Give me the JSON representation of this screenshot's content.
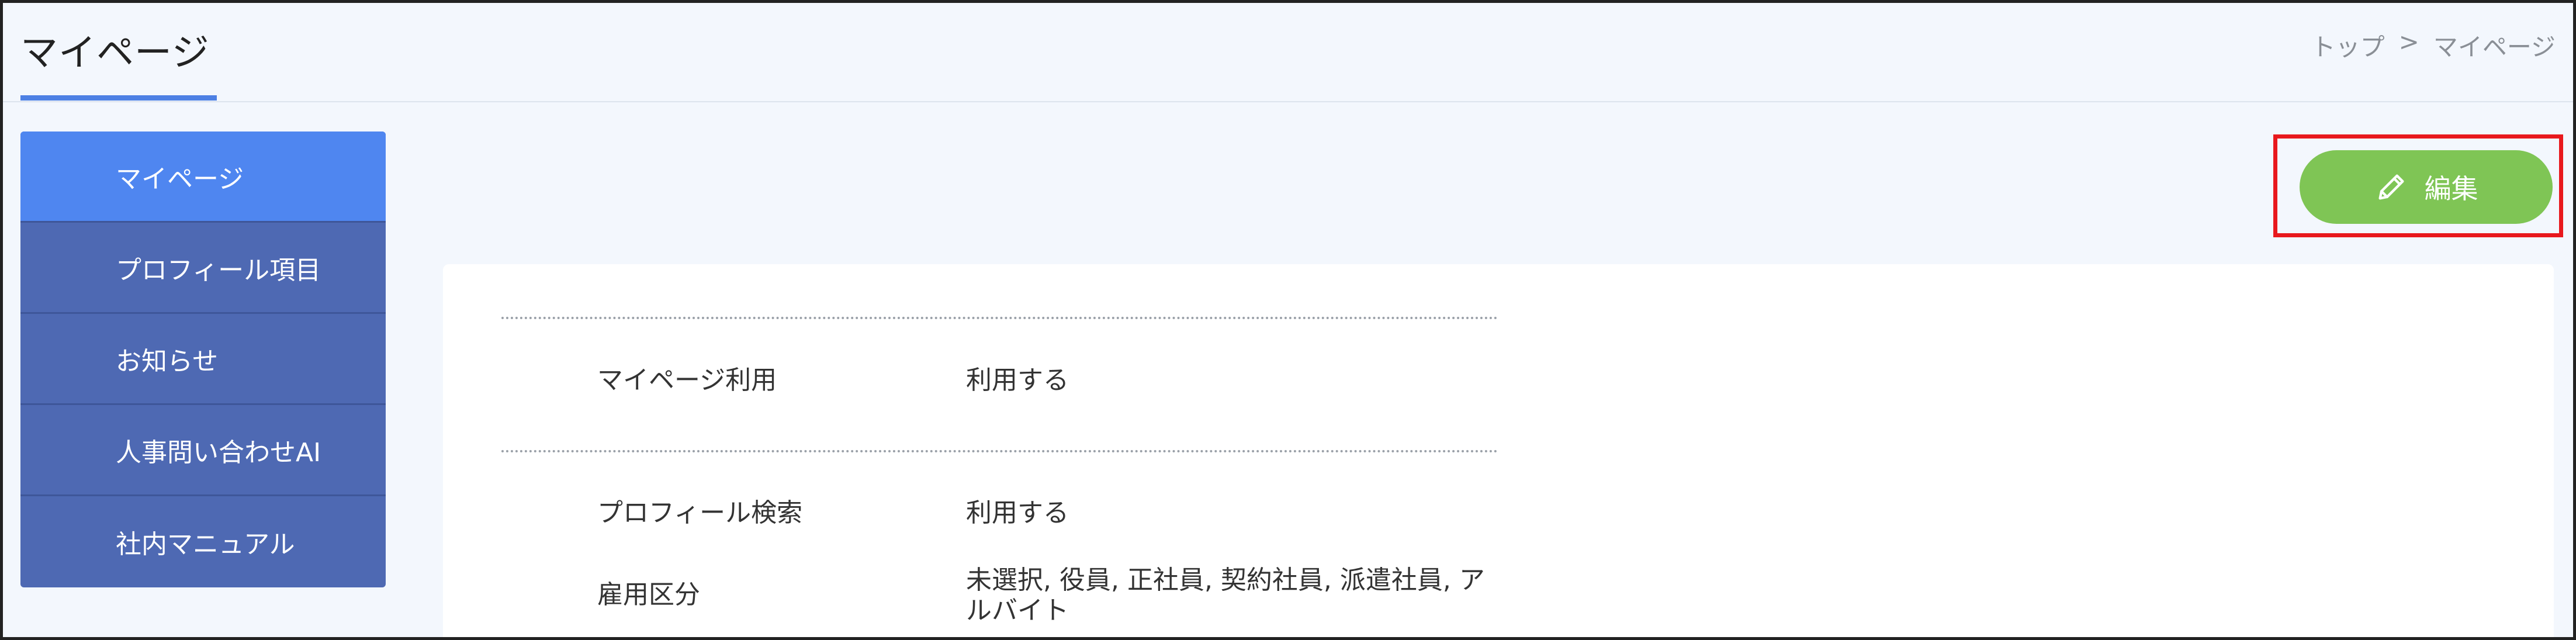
{
  "header": {
    "title": "マイページ",
    "breadcrumb": {
      "top": "トップ",
      "separator": ">",
      "current": "マイページ"
    }
  },
  "sidebar": {
    "items": [
      {
        "label": "マイページ",
        "active": true
      },
      {
        "label": "プロフィール項目",
        "active": false
      },
      {
        "label": "お知らせ",
        "active": false
      },
      {
        "label": "人事問い合わせAI",
        "active": false
      },
      {
        "label": "社内マニュアル",
        "active": false
      }
    ]
  },
  "toolbar": {
    "edit_label": "編集",
    "edit_icon": "pencil-icon"
  },
  "settings": {
    "rows": [
      {
        "label": "マイページ利用",
        "value": "利用する"
      },
      {
        "label": "プロフィール検索",
        "value": "利用する"
      },
      {
        "label": "雇用区分",
        "value": "未選択, 役員, 正社員, 契約社員, 派遣社員, アルバイト"
      }
    ]
  },
  "colors": {
    "background": "#f3f7fd",
    "accent": "#4d80e4",
    "sidebar": "#4e69b3",
    "sidebar_active": "#4f86f0",
    "edit_button": "#7fc555",
    "highlight": "#e8191d"
  }
}
